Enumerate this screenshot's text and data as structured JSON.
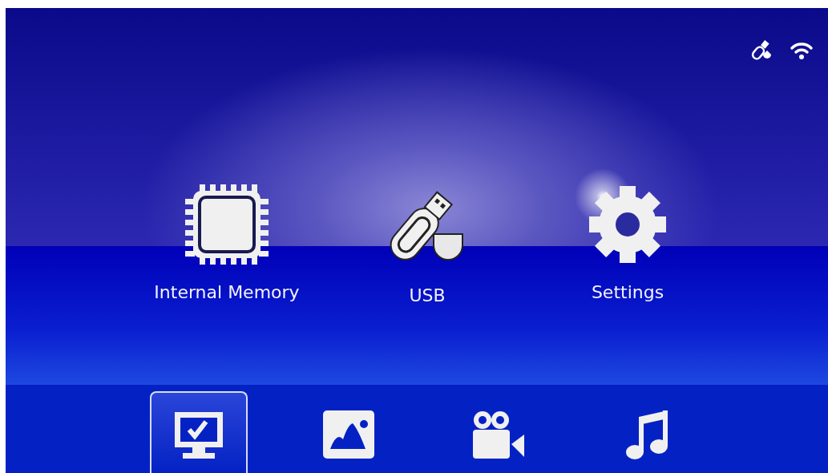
{
  "sources": [
    {
      "kind": "memory",
      "label": "Internal Memory"
    },
    {
      "kind": "usb",
      "label": "USB"
    },
    {
      "kind": "settings",
      "label": "Settings"
    }
  ],
  "dock": [
    {
      "kind": "source",
      "selected": true
    },
    {
      "kind": "photo",
      "selected": false
    },
    {
      "kind": "video",
      "selected": false
    },
    {
      "kind": "music",
      "selected": false
    }
  ]
}
